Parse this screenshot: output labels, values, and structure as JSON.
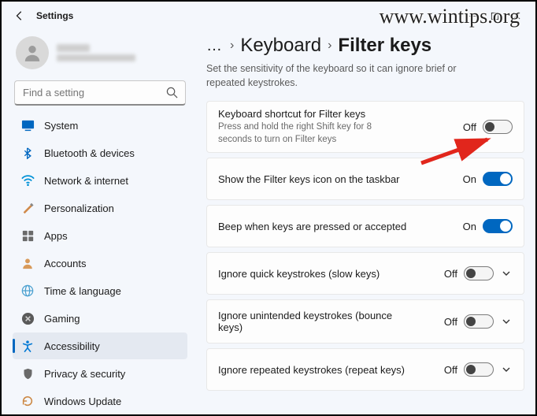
{
  "watermark": "www.wintips.org",
  "title": "Settings",
  "search": {
    "placeholder": "Find a setting"
  },
  "sidebar": {
    "items": [
      {
        "label": "System"
      },
      {
        "label": "Bluetooth & devices"
      },
      {
        "label": "Network & internet"
      },
      {
        "label": "Personalization"
      },
      {
        "label": "Apps"
      },
      {
        "label": "Accounts"
      },
      {
        "label": "Time & language"
      },
      {
        "label": "Gaming"
      },
      {
        "label": "Accessibility"
      },
      {
        "label": "Privacy & security"
      },
      {
        "label": "Windows Update"
      }
    ]
  },
  "breadcrumb": {
    "ellipsis": "…",
    "level1": "Keyboard",
    "current": "Filter keys"
  },
  "description": "Set the sensitivity of the keyboard so it can ignore brief or repeated keystrokes.",
  "cards": [
    {
      "title": "Keyboard shortcut for Filter keys",
      "sub": "Press and hold the right Shift key for 8 seconds to turn on Filter keys",
      "state": "Off",
      "on": false,
      "expand": false
    },
    {
      "title": "Show the Filter keys icon on the taskbar",
      "sub": "",
      "state": "On",
      "on": true,
      "expand": false
    },
    {
      "title": "Beep when keys are pressed or accepted",
      "sub": "",
      "state": "On",
      "on": true,
      "expand": false
    },
    {
      "title": "Ignore quick keystrokes (slow keys)",
      "sub": "",
      "state": "Off",
      "on": false,
      "expand": true
    },
    {
      "title": "Ignore unintended keystrokes (bounce keys)",
      "sub": "",
      "state": "Off",
      "on": false,
      "expand": true
    },
    {
      "title": "Ignore repeated keystrokes (repeat keys)",
      "sub": "",
      "state": "Off",
      "on": false,
      "expand": true
    }
  ]
}
